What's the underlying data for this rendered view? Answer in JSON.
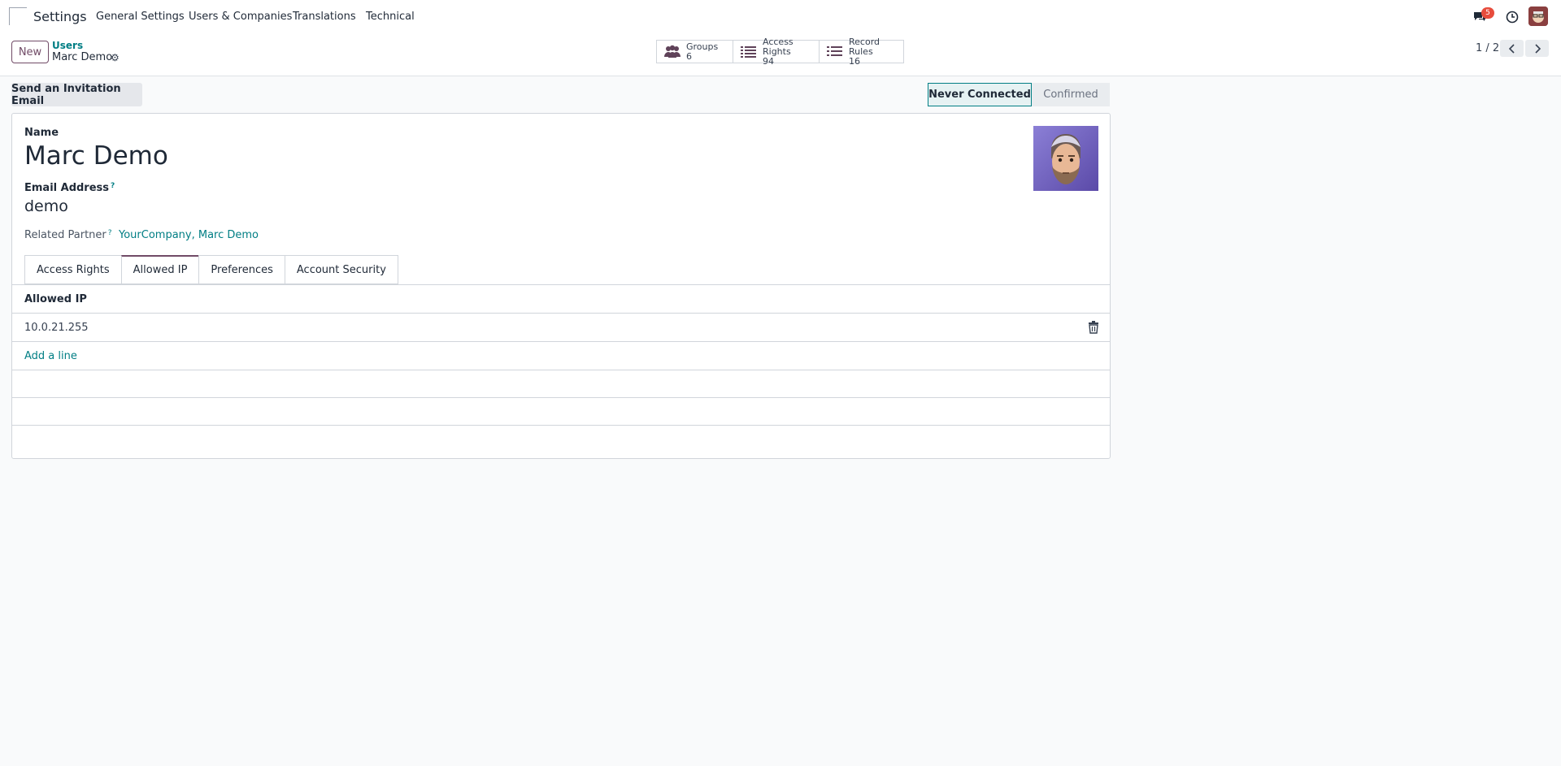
{
  "navbar": {
    "app_name": "Settings",
    "menus": [
      "General Settings",
      "Users & Companies",
      "Translations",
      "Technical"
    ],
    "messages_badge": "5"
  },
  "control": {
    "new_label": "New",
    "breadcrumb_parent": "Users",
    "breadcrumb_current": "Marc Demo",
    "stats": [
      {
        "label": "Groups",
        "value": "6",
        "icon": "users-icon"
      },
      {
        "label": "Access Rights",
        "value": "94",
        "icon": "list-icon"
      },
      {
        "label": "Record Rules",
        "value": "16",
        "icon": "list-icon"
      }
    ],
    "pager": "1 / 2"
  },
  "statusbar": {
    "invite_label": "Send an Invitation Email",
    "stages": [
      "Never Connected",
      "Confirmed"
    ],
    "active_stage": "Never Connected"
  },
  "form": {
    "name_label": "Name",
    "name_value": "Marc Demo",
    "email_label": "Email Address",
    "email_tip": "?",
    "email_value": "demo",
    "partner_label": "Related Partner",
    "partner_tip": "?",
    "partner_value": "YourCompany, Marc Demo",
    "tabs": [
      "Access Rights",
      "Allowed IP",
      "Preferences",
      "Account Security"
    ],
    "active_tab": "Allowed IP",
    "list_header": "Allowed IP",
    "rows": [
      "10.0.21.255"
    ],
    "add_line_label": "Add a line"
  }
}
